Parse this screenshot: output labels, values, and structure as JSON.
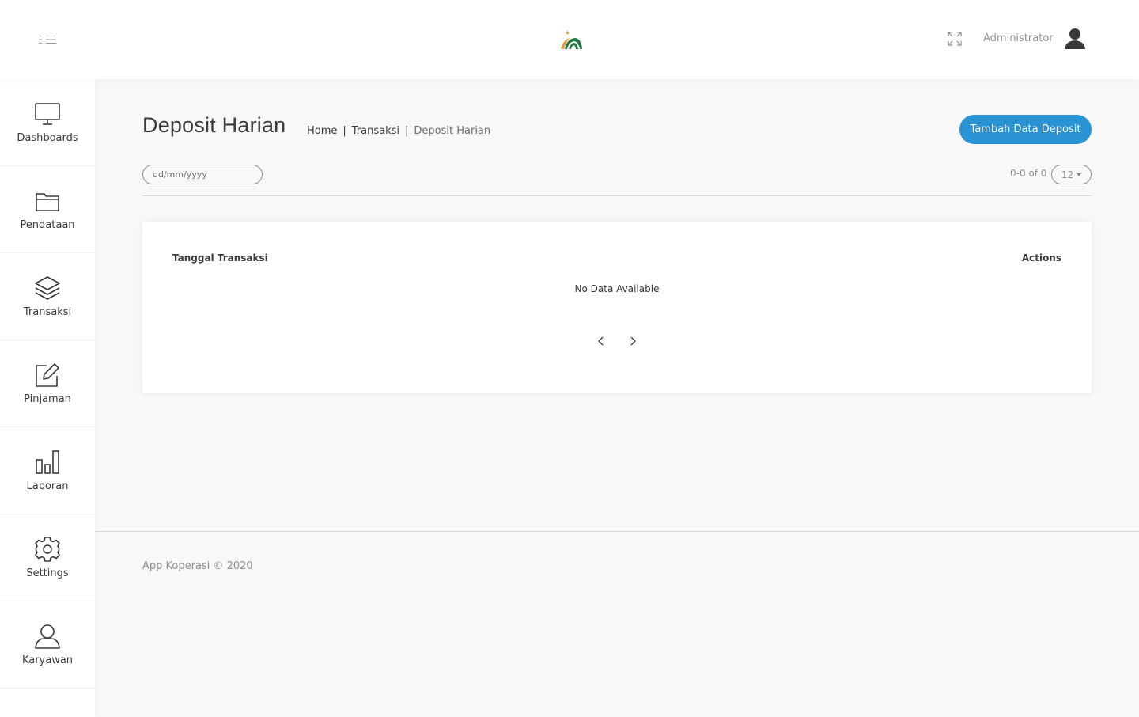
{
  "header": {
    "user_name": "Administrator"
  },
  "sidebar": {
    "items": [
      {
        "label": "Dashboards",
        "icon": "monitor-icon"
      },
      {
        "label": "Pendataan",
        "icon": "folder-icon"
      },
      {
        "label": "Transaksi",
        "icon": "layers-icon"
      },
      {
        "label": "Pinjaman",
        "icon": "edit-icon"
      },
      {
        "label": "Laporan",
        "icon": "bar-chart-icon"
      },
      {
        "label": "Settings",
        "icon": "gear-icon"
      },
      {
        "label": "Karyawan",
        "icon": "user-icon"
      }
    ]
  },
  "page": {
    "title": "Deposit Harian",
    "breadcrumb": [
      "Home",
      "Transaksi",
      "Deposit Harian"
    ],
    "add_button": "Tambah Data Deposit",
    "date_placeholder": "dd/mm/yyyy",
    "page_count": "0-0 of 0",
    "page_size": "12"
  },
  "table": {
    "columns": [
      "Tanggal Transaksi",
      "Actions"
    ],
    "empty_text": "No Data Available"
  },
  "footer": {
    "text": "App Koperasi © 2020"
  },
  "colors": {
    "accent": "#2a93d5",
    "logo_green": "#1e7b45",
    "logo_orange": "#e8a33d"
  }
}
